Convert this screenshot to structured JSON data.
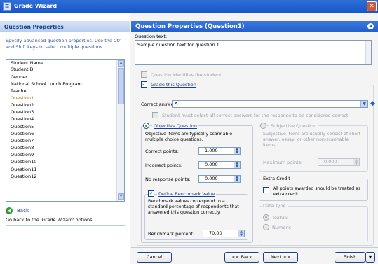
{
  "window": {
    "title": "Grade Wizard"
  },
  "left": {
    "header": "Question Properties",
    "description": "Specify advanced question properties. Use the Ctrl and Shift keys to select multiple questions.",
    "list_items": [
      "Student Name",
      "StudentID",
      "Gender",
      "National School Lunch Program",
      "Teacher",
      "Question1",
      "Question2",
      "Question3",
      "Question4",
      "Question5",
      "Question6",
      "Question7",
      "Question8",
      "Question9",
      "Question10",
      "Question11",
      "Question12"
    ],
    "selected_item": "Question1",
    "back_label": "Back",
    "back_description": "Go back to the 'Grade Wizard' options."
  },
  "right": {
    "header": "Question Properties (Question1)",
    "question_text_label": "Question text:",
    "question_text_value": "Sample question text for question 1",
    "identifies_student_label": "Question identifies the student",
    "grade_question_label": "Grade this Question",
    "correct_answers_label": "Correct answer(s):",
    "correct_answers_value": "A",
    "must_select_all_label": "Student must select all correct answers for the response to be considered correct",
    "objective": {
      "label": "Objective Question",
      "description": "Objective items are typically scannable multiple choice questions.",
      "correct_points_label": "Correct points:",
      "correct_points_value": "1.000",
      "incorrect_points_label": "Incorrect points:",
      "incorrect_points_value": "0.000",
      "no_response_label": "No response points:",
      "no_response_value": "0.000"
    },
    "benchmark": {
      "label": "Define Benchmark Value",
      "description": "Benchmark values correspond to a standard percentage of respondents that answered this question correctly.",
      "percent_label": "Benchmark percent:",
      "percent_value": "70.00"
    },
    "subjective": {
      "label": "Subjective Question",
      "description": "Subjective items are usually consist of short answer, essay, or other non-scannable items.",
      "max_points_label": "Maximum points:",
      "max_points_value": "0.000"
    },
    "extra_credit": {
      "title": "Extra Credit",
      "label": "All points awarded should be treated as extra credit"
    },
    "data_type": {
      "title": "Data Type",
      "textual": "Textual",
      "numeric": "Numeric"
    },
    "buttons": {
      "cancel": "Cancel",
      "back": "<< Back",
      "next": "Next >>",
      "finish": "Finish"
    }
  }
}
